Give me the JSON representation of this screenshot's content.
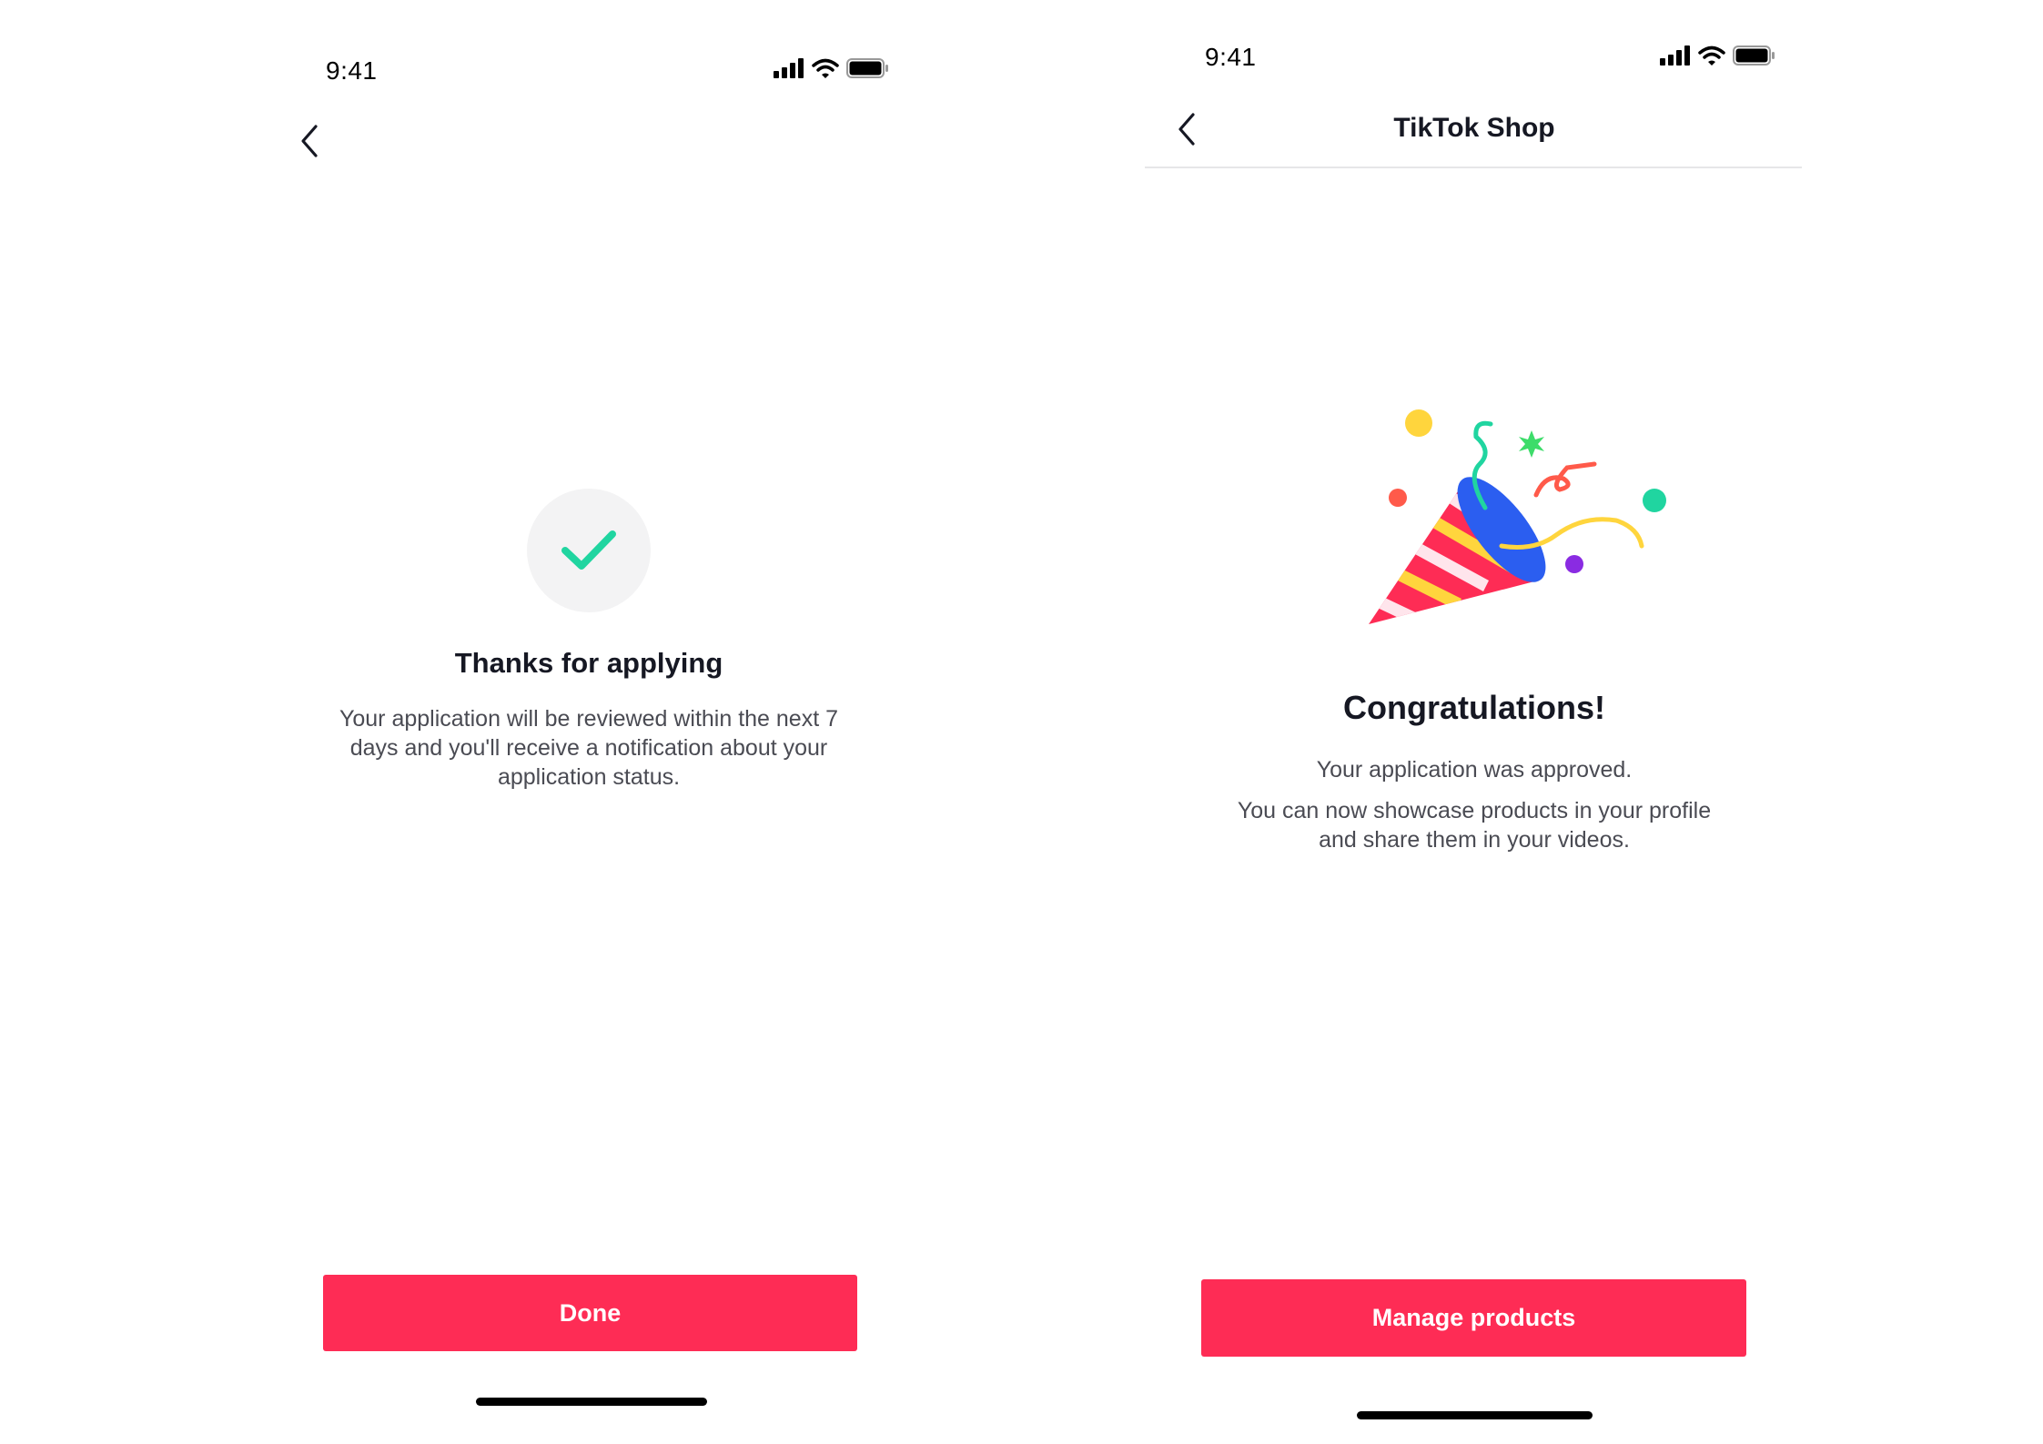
{
  "left_screen": {
    "status_bar": {
      "time": "9:41",
      "icons": [
        "cellular-signal-icon",
        "wifi-icon",
        "battery-icon"
      ]
    },
    "nav": {
      "back_icon": "chevron-left-icon"
    },
    "check_icon": "checkmark-icon",
    "title": "Thanks for applying",
    "body_lines": [
      "Your application will be reviewed within the next 7",
      "days and you'll receive a notification about your",
      "application status."
    ],
    "primary_button_label": "Done"
  },
  "right_screen": {
    "status_bar": {
      "time": "9:41",
      "icons": [
        "cellular-signal-icon",
        "wifi-icon",
        "battery-icon"
      ]
    },
    "nav": {
      "back_icon": "chevron-left-icon",
      "title": "TikTok Shop"
    },
    "illustration": "party-popper-icon",
    "title": "Congratulations!",
    "body_line_1": "Your application was approved.",
    "body_lines_2": [
      "You can now showcase products in your profile",
      "and share them in your videos."
    ],
    "primary_button_label": "Manage products"
  },
  "colors": {
    "primary": "#fe2c55",
    "success": "#20d5a0",
    "text_primary": "#161823",
    "text_secondary": "#4a4b53",
    "icon_background": "#f3f3f4"
  }
}
